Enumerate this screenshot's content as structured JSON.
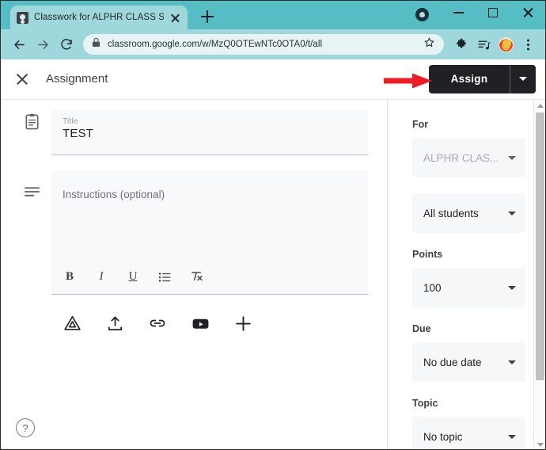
{
  "browser": {
    "tab": {
      "title": "Classwork for ALPHR CLASS SAM",
      "favicon": "classroom-favicon",
      "close": "close-tab-icon"
    },
    "new_tab_tooltip": "New tab",
    "window": {
      "minimize": "minimize-icon",
      "maximize": "maximize-icon",
      "close": "close-window-icon"
    },
    "nav": {
      "back": "back-arrow-icon",
      "forward": "forward-arrow-icon",
      "reload": "reload-icon"
    },
    "omnibox": {
      "lock": "lock-icon",
      "url": "classroom.google.com/w/MzQ0OTEwNTc0OTA0/t/all",
      "bookmark": "star-icon"
    },
    "toolbar": {
      "extensions": "puzzle-piece-icon",
      "reading_list": "reading-list-icon",
      "profile": "profile-avatar",
      "menu": "kebab-menu-icon"
    },
    "colors": {
      "tabstrip": "#57bdc5",
      "toolbar": "#9ed8dc",
      "omnibox": "#e7f3f4"
    }
  },
  "app_header": {
    "close_icon": "close-icon",
    "title": "Assignment",
    "assign_label": "Assign",
    "assign_caret": "chevron-down-icon",
    "annotation": "red-arrow-pointing-at-assign",
    "assign_bg": "#202124",
    "annotation_color": "#ee1c25"
  },
  "form": {
    "title_field": {
      "icon": "clipboard-icon",
      "label": "Title",
      "value": "TEST"
    },
    "instructions_field": {
      "icon": "description-lines-icon",
      "placeholder": "Instructions (optional)",
      "value": ""
    },
    "format_toolbar": [
      {
        "name": "bold-button",
        "glyph": "B"
      },
      {
        "name": "italic-button",
        "glyph": "I"
      },
      {
        "name": "underline-button",
        "glyph": "U"
      },
      {
        "name": "bulleted-list-button",
        "glyph": "list"
      },
      {
        "name": "clear-formatting-button",
        "glyph": "clear"
      }
    ],
    "attachments": [
      {
        "name": "google-drive-button",
        "label": "Drive"
      },
      {
        "name": "upload-button",
        "label": "Upload"
      },
      {
        "name": "link-button",
        "label": "Link"
      },
      {
        "name": "youtube-button",
        "label": "YouTube"
      },
      {
        "name": "create-button",
        "label": "Create"
      }
    ],
    "help": "?"
  },
  "sidebar": {
    "sections": [
      {
        "label": "For",
        "selects": [
          {
            "name": "class-select",
            "value": "ALPHR CLAS...",
            "disabled": true
          },
          {
            "name": "students-select",
            "value": "All students",
            "disabled": false
          }
        ]
      },
      {
        "label": "Points",
        "selects": [
          {
            "name": "points-select",
            "value": "100",
            "disabled": false
          }
        ]
      },
      {
        "label": "Due",
        "selects": [
          {
            "name": "due-select",
            "value": "No due date",
            "disabled": false
          }
        ]
      },
      {
        "label": "Topic",
        "selects": [
          {
            "name": "topic-select",
            "value": "No topic",
            "disabled": false
          }
        ]
      }
    ]
  }
}
